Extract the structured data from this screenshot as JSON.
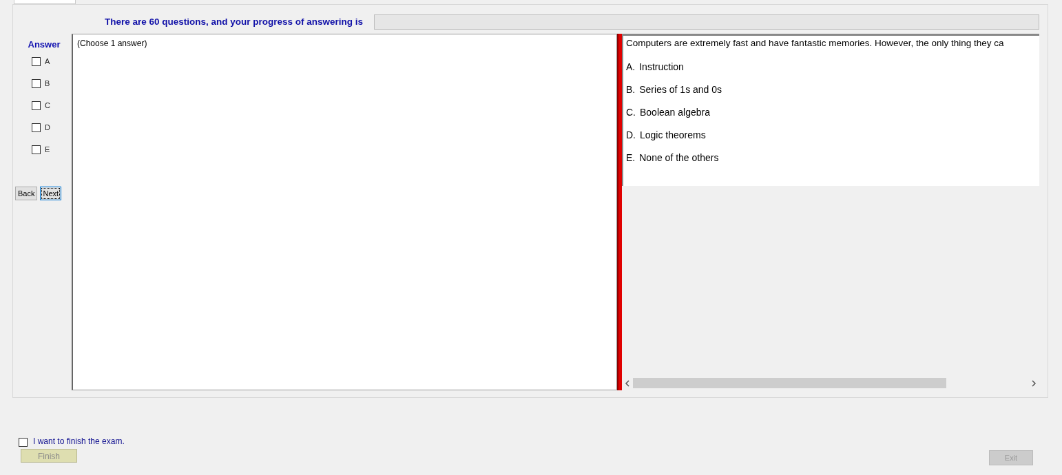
{
  "header": {
    "text": "There are 60 questions, and your progress of answering is",
    "progress": {
      "level": 0
    }
  },
  "answer_panel": {
    "title": "Answer",
    "options": [
      {
        "label": "A",
        "checked": false
      },
      {
        "label": "B",
        "checked": false
      },
      {
        "label": "C",
        "checked": false
      },
      {
        "label": "D",
        "checked": false
      },
      {
        "label": "E",
        "checked": false
      }
    ]
  },
  "nav_buttons": [
    {
      "label": "Back",
      "focused": false
    },
    {
      "label": "Next",
      "focused": true
    }
  ],
  "answer_box": {
    "text": "(Choose 1 answer)"
  },
  "question": {
    "text": "Computers are extremely fast and have fantastic memories. However, the only thing they ca",
    "choices": [
      {
        "letter": "A.",
        "text": "Instruction"
      },
      {
        "letter": "B.",
        "text": "Series of 1s and 0s"
      },
      {
        "letter": "C.",
        "text": "Boolean algebra"
      },
      {
        "letter": "D.",
        "text": "Logic theorems"
      },
      {
        "letter": "E.",
        "text": "None of the others"
      }
    ]
  },
  "finish": {
    "label": "I want to finish the exam.",
    "checked": false,
    "button": {
      "label": "Finish",
      "disabled": true
    }
  },
  "exit_button": {
    "label": "Exit",
    "disabled": true
  }
}
